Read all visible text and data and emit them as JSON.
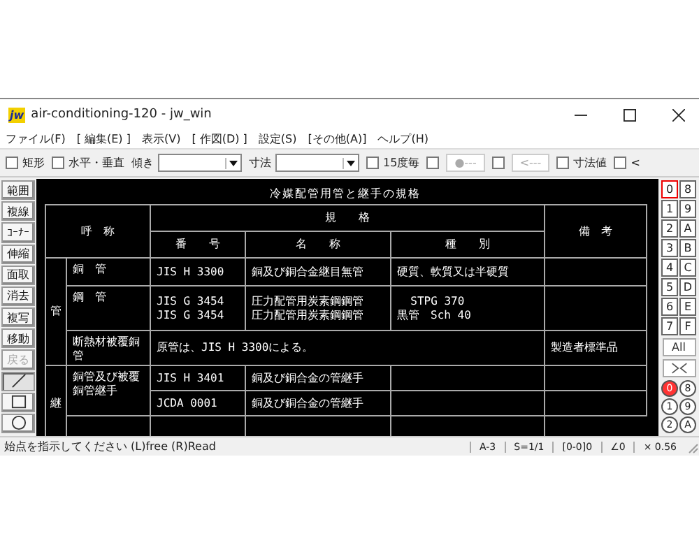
{
  "window": {
    "app_icon": "jw",
    "title": "air-conditioning-120 - jw_win"
  },
  "menu": [
    "ファイル(F)",
    "[ 編集(E) ]",
    "表示(V)",
    "[ 作図(D) ]",
    "設定(S)",
    "[その他(A)]",
    "ヘルプ(H)"
  ],
  "toolbar": [
    {
      "kind": "checkbox",
      "label": "矩形",
      "checked": false
    },
    {
      "kind": "checkbox",
      "label": "水平・垂直",
      "checked": false
    },
    {
      "kind": "combo",
      "label": "傾き"
    },
    {
      "kind": "combo",
      "label": "寸法"
    },
    {
      "kind": "checkbox",
      "label": "15度毎",
      "checked": false
    },
    {
      "kind": "checkbox",
      "checked": false
    },
    {
      "kind": "button",
      "label": "●---",
      "disabled": true
    },
    {
      "kind": "checkbox",
      "checked": false
    },
    {
      "kind": "button",
      "label": "<---",
      "disabled": true
    },
    {
      "kind": "checkbox",
      "label": "寸法値",
      "checked": false
    },
    {
      "kind": "checkbox",
      "label": "<",
      "checked": false
    }
  ],
  "tools": [
    {
      "kind": "text",
      "label": "範囲",
      "disabled": false
    },
    {
      "kind": "text",
      "label": "複線",
      "disabled": false
    },
    {
      "kind": "text",
      "label": "ｺｰﾅｰ",
      "disabled": false
    },
    {
      "kind": "text",
      "label": "伸縮",
      "disabled": false
    },
    {
      "kind": "text",
      "label": "面取",
      "disabled": false
    },
    {
      "kind": "text",
      "label": "消去",
      "disabled": false
    },
    {
      "kind": "text",
      "label": "複写",
      "disabled": false
    },
    {
      "kind": "text",
      "label": "移動",
      "disabled": false
    },
    {
      "kind": "text",
      "label": "戻る",
      "disabled": true
    },
    {
      "kind": "line",
      "selected": true
    },
    {
      "kind": "rect",
      "selected": false
    },
    {
      "kind": "circle",
      "selected": false
    }
  ],
  "drawing": {
    "title": "冷媒配管用管と継手の規格",
    "headers": {
      "name": "呼　称",
      "spec": "規　　格",
      "number": "番　　号",
      "spec_name": "名　　称",
      "type": "種　　別",
      "remarks": "備　考"
    },
    "groups": [
      {
        "label": "管",
        "rows": [
          {
            "name": "銅　管",
            "number": [
              "JIS H 3300"
            ],
            "spec_name": [
              "銅及び銅合金継目無管"
            ],
            "type": [
              "硬質、軟質又は半硬質"
            ],
            "remarks": ""
          },
          {
            "name": "鋼　管",
            "number": [
              "JIS G 3454",
              "JIS G 3454"
            ],
            "spec_name": [
              "圧力配管用炭素鋼鋼管",
              "圧力配管用炭素鋼鋼管"
            ],
            "type": [
              "  STPG 370",
              "黒管　Sch 40"
            ],
            "remarks": ""
          },
          {
            "name": "断熱材被覆銅管",
            "note": "原管は、JIS H 3300による。",
            "remarks": "製造者標準品"
          }
        ]
      },
      {
        "label": "継",
        "rows": [
          {
            "name": "銅管及び被覆銅管継手",
            "number": [
              "JIS H 3401"
            ],
            "spec_name": [
              "銅及び銅合金の管継手"
            ],
            "type": [],
            "remarks": ""
          },
          {
            "number": [
              "JCDA 0001"
            ],
            "spec_name": [
              "銅及び銅合金の管継手"
            ],
            "type": [],
            "remarks": ""
          },
          {
            "number": [],
            "spec_name": [],
            "type": [],
            "remarks": ""
          }
        ]
      }
    ]
  },
  "layer_groups": [
    {
      "label": "0",
      "selected": true
    },
    {
      "label": "8",
      "selected": false
    },
    {
      "label": "1",
      "selected": false
    },
    {
      "label": "9",
      "selected": false
    },
    {
      "label": "2",
      "selected": false
    },
    {
      "label": "A",
      "selected": false
    },
    {
      "label": "3",
      "selected": false
    },
    {
      "label": "B",
      "selected": false
    },
    {
      "label": "4",
      "selected": false
    },
    {
      "label": "C",
      "selected": false
    },
    {
      "label": "5",
      "selected": false
    },
    {
      "label": "D",
      "selected": false
    },
    {
      "label": "6",
      "selected": false
    },
    {
      "label": "E",
      "selected": false
    },
    {
      "label": "7",
      "selected": false
    },
    {
      "label": "F",
      "selected": false
    }
  ],
  "layer_all": "All",
  "layers": [
    {
      "label": "0",
      "selected": true
    },
    {
      "label": "8",
      "selected": false
    },
    {
      "label": "1",
      "selected": false
    },
    {
      "label": "9",
      "selected": false
    },
    {
      "label": "2",
      "selected": false
    },
    {
      "label": "A",
      "selected": false
    }
  ],
  "status_bar": {
    "message": "始点を指示してください (L)free (R)Read",
    "cells": [
      "A-3",
      "S=1/1",
      "[0-0]0",
      "∠0",
      "× 0.56"
    ]
  }
}
